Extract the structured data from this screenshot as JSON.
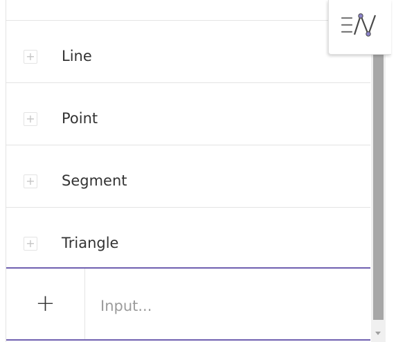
{
  "algebra_panel": {
    "objects": [
      {
        "label": "Line",
        "icon": "plus-icon"
      },
      {
        "label": "Point",
        "icon": "plus-icon"
      },
      {
        "label": "Segment",
        "icon": "plus-icon"
      },
      {
        "label": "Triangle",
        "icon": "plus-icon"
      }
    ],
    "input": {
      "add_symbol": "+",
      "placeholder": "Input...",
      "value": ""
    }
  },
  "toolbar": {
    "algebra_view_icon": "algebra-view-icon"
  },
  "colors": {
    "accent": "#6f5fb0",
    "scrollbar_thumb": "#a7a7a7",
    "text": "#333333",
    "placeholder": "#9b9b9b"
  }
}
